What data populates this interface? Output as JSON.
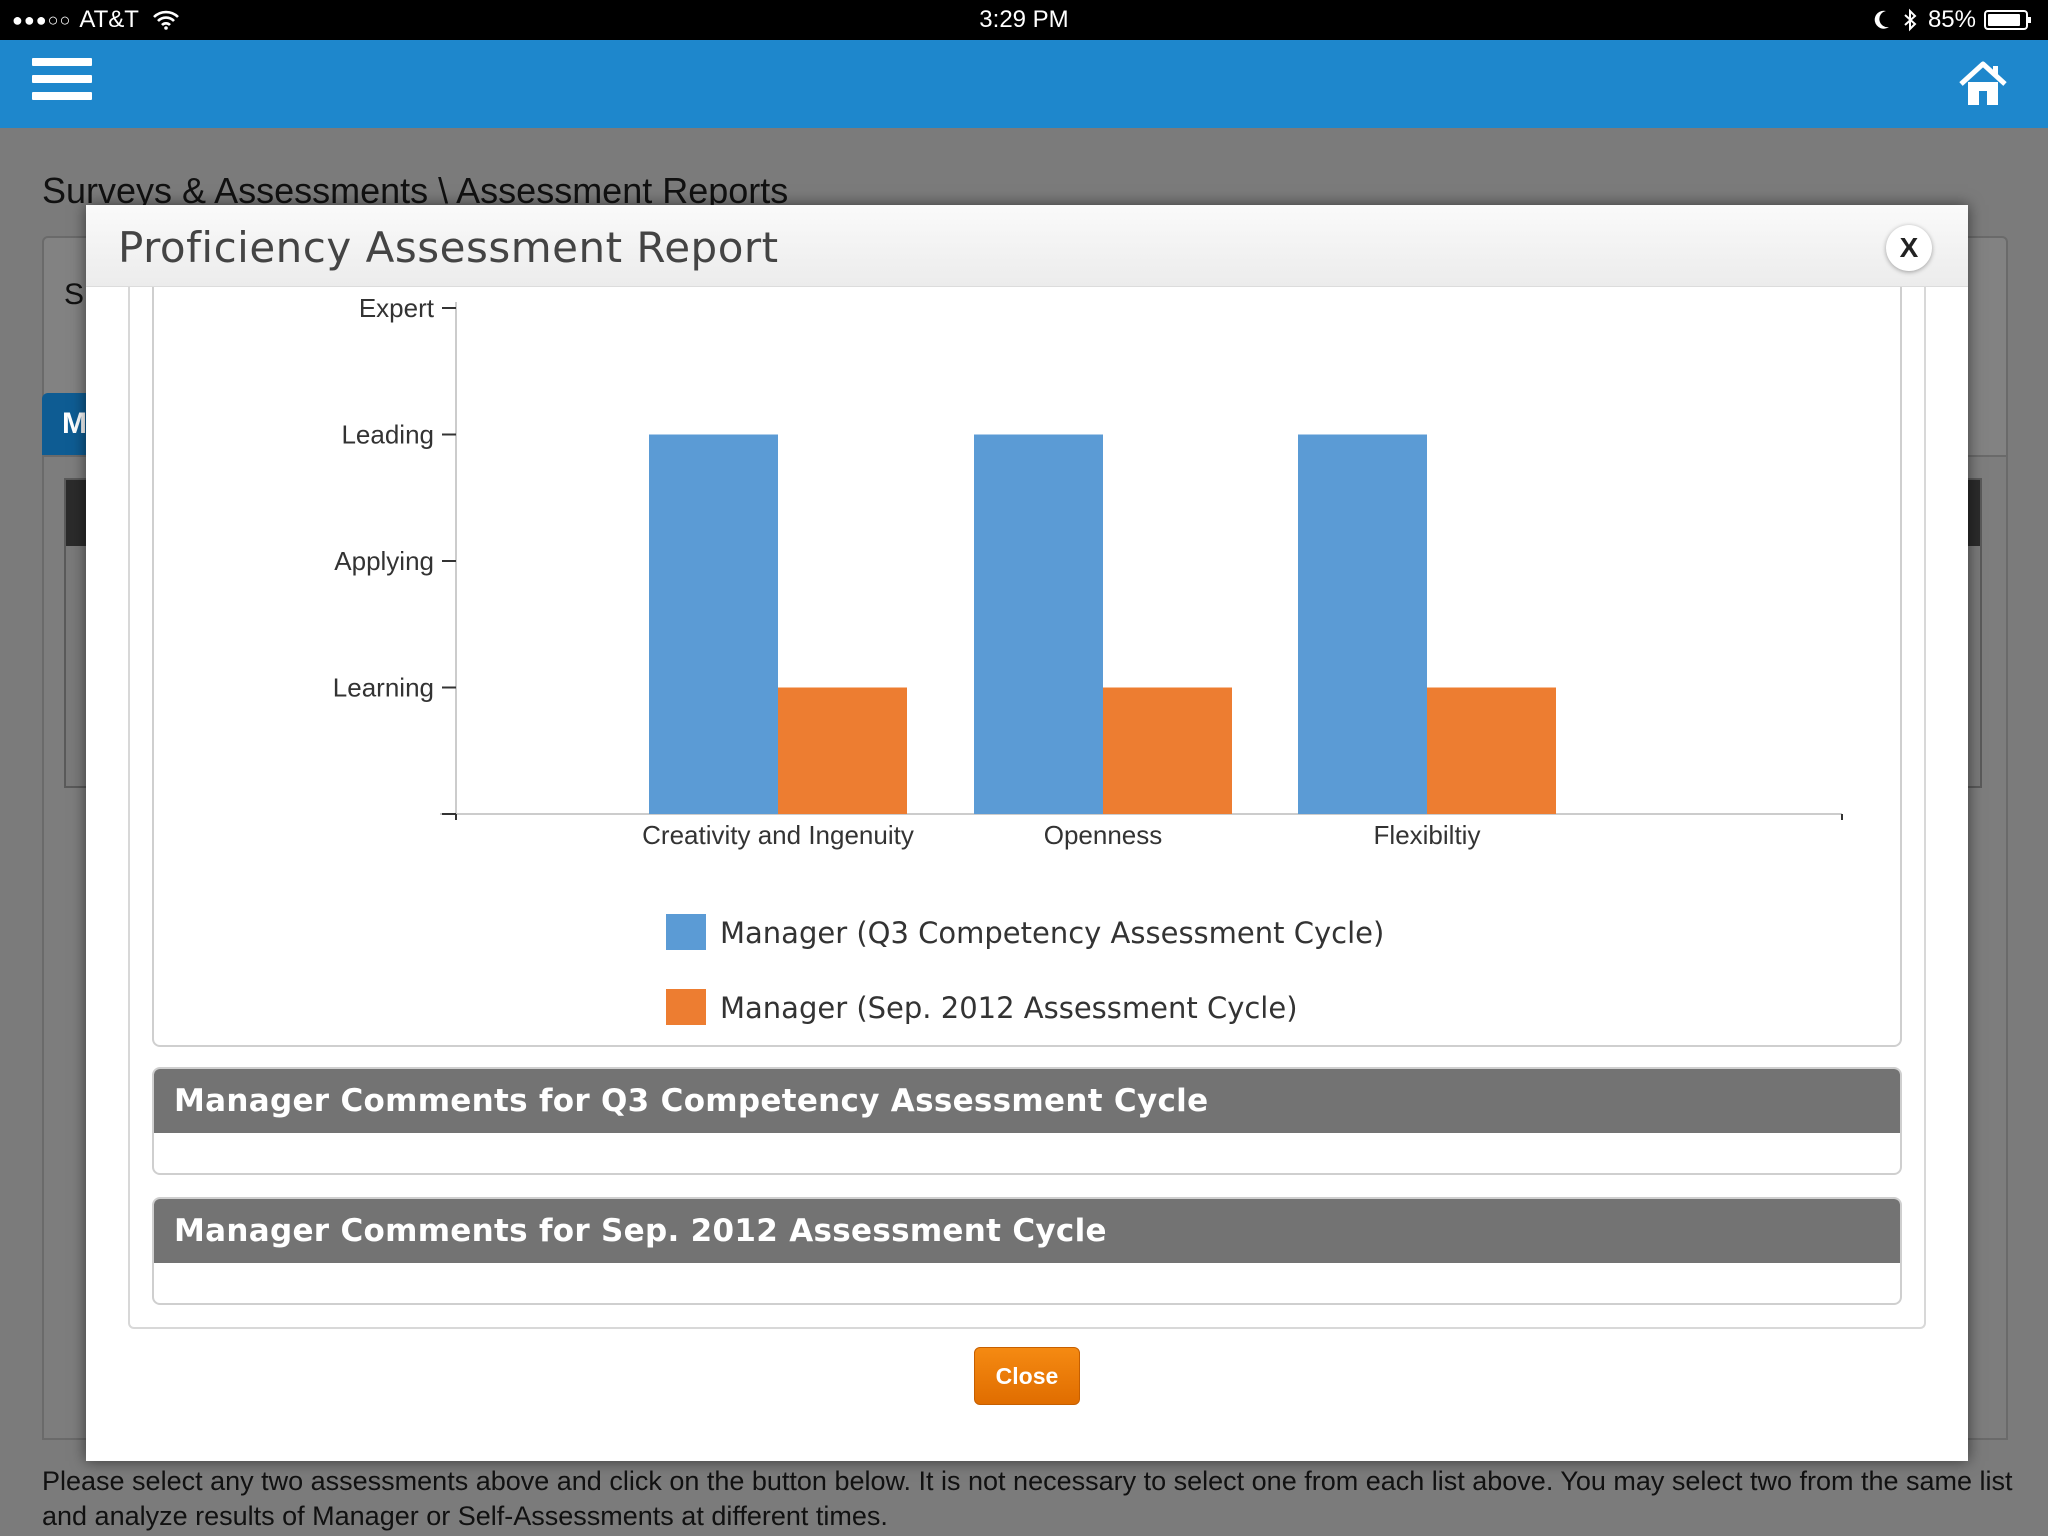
{
  "status_bar": {
    "carrier": "AT&T",
    "signal": "●●●○○",
    "time": "3:29 PM",
    "battery": "85%"
  },
  "header": {
    "menu_icon": "hamburger-menu-icon",
    "home_icon": "home-icon",
    "color": "#1e87cc"
  },
  "background": {
    "breadcrumb": "Surveys & Assessments \\ Assessment Reports",
    "box_letter": "S",
    "tab_letter": "M",
    "footer": "Please select any two assessments above and click on the button below. It is not necessary to select one from each list above. You may select two from the same list and analyze results of Manager or Self-Assessments at different times."
  },
  "modal": {
    "title": "Proficiency Assessment Report",
    "close_x": "X",
    "comments": [
      {
        "title": "Manager Comments for Q3 Competency Assessment Cycle",
        "body": ""
      },
      {
        "title": "Manager Comments for Sep. 2012 Assessment Cycle",
        "body": ""
      }
    ],
    "close_button": "Close"
  },
  "chart_data": {
    "type": "bar",
    "categories": [
      "Creativity and Ingenuity",
      "Openness",
      "Flexibiltiy"
    ],
    "y_levels": [
      "Learning",
      "Applying",
      "Leading",
      "Expert"
    ],
    "ylim": [
      0,
      4
    ],
    "series": [
      {
        "name": "Manager (Q3 Competency Assessment Cycle)",
        "color": "#5b9bd5",
        "values": [
          3,
          3,
          3
        ]
      },
      {
        "name": "Manager (Sep. 2012 Assessment Cycle)",
        "color": "#ed7d31",
        "values": [
          1,
          1,
          1
        ]
      }
    ],
    "legend_position": "bottom"
  }
}
